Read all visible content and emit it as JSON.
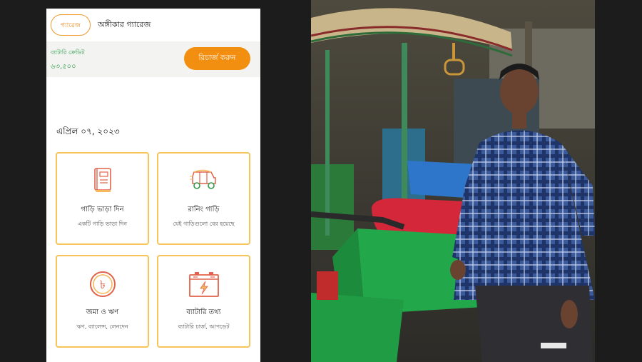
{
  "app": {
    "garage_chip": "গ্যারেজ",
    "garage_name": "অঙ্গীকার গ্যারেজ",
    "credit_label": "ব্যাটারি ক্রেডিট",
    "credit_amount": "৬৩,৫০০",
    "recharge_label": "রিচার্জ করুন",
    "date": "এপ্রিল ০৭, ২০২৩",
    "cards": [
      {
        "title": "গাড়ি ভাড়া দিন",
        "subtitle": "একটি গাড়ি ভাড়া দিন",
        "icon": "book-icon"
      },
      {
        "title": "রানিং গাড়ি",
        "subtitle": "যেই গাড়িগুলো বের হয়েছে",
        "icon": "auto-rickshaw-icon"
      },
      {
        "title": "জমা ও ঋণ",
        "subtitle": "ঋণ, ব্যালেন্স, লেনদেন",
        "icon": "taka-coin-icon"
      },
      {
        "title": "ব্যাটারি তথ্য",
        "subtitle": "ব্যাটারি চার্জ, আপডেট",
        "icon": "battery-icon"
      }
    ]
  },
  "colors": {
    "accent": "#f28e10",
    "card_border": "#f6c45a",
    "credit_text": "#2f9b4a"
  }
}
